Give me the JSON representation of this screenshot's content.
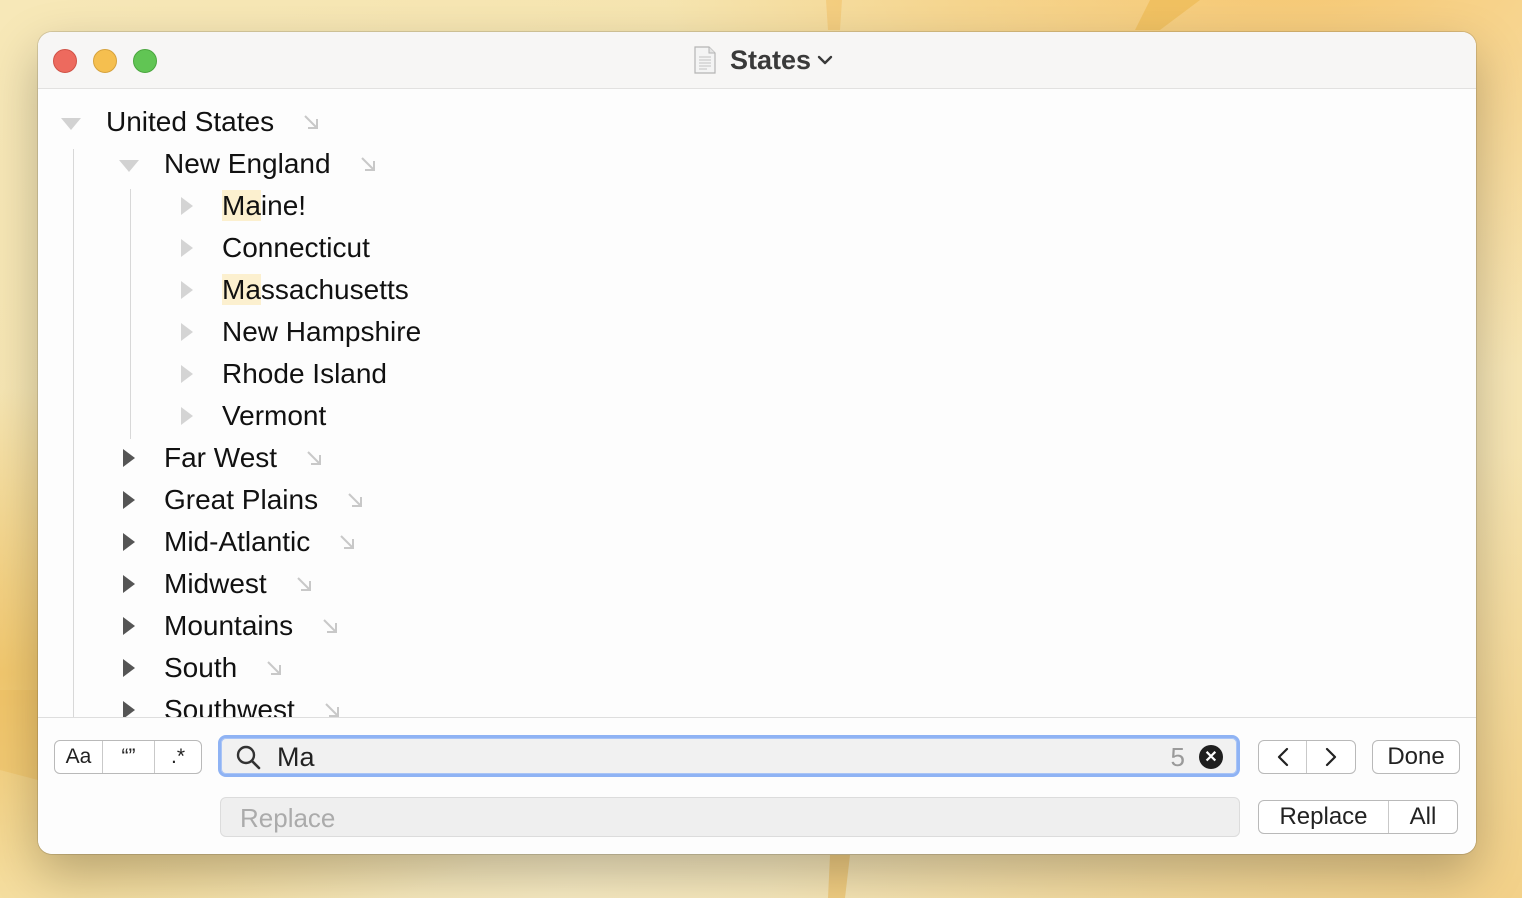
{
  "window": {
    "title": "States"
  },
  "outline": {
    "root": {
      "label": "United States"
    },
    "new_england": {
      "label": "New England",
      "children": [
        {
          "match": "Ma",
          "rest": "ine!"
        },
        {
          "match": "",
          "rest": "Connecticut"
        },
        {
          "match": "Ma",
          "rest": "ssachusetts"
        },
        {
          "match": "",
          "rest": "New Hampshire"
        },
        {
          "match": "",
          "rest": "Rhode Island"
        },
        {
          "match": "",
          "rest": "Vermont"
        }
      ]
    },
    "regions": [
      "Far West",
      "Great Plains",
      "Mid-Atlantic",
      "Midwest",
      "Mountains",
      "South",
      "Southwest"
    ]
  },
  "find": {
    "options": {
      "case": "Aa",
      "whole_word": "“”",
      "regex": ".*"
    },
    "query": "Ma",
    "match_count": "5",
    "replace_placeholder": "Replace",
    "done_label": "Done",
    "replace_label": "Replace",
    "replace_all_label": "All"
  },
  "colors": {
    "match_highlight": "#fcf0cf",
    "focus_ring": "#8fb3f4"
  }
}
